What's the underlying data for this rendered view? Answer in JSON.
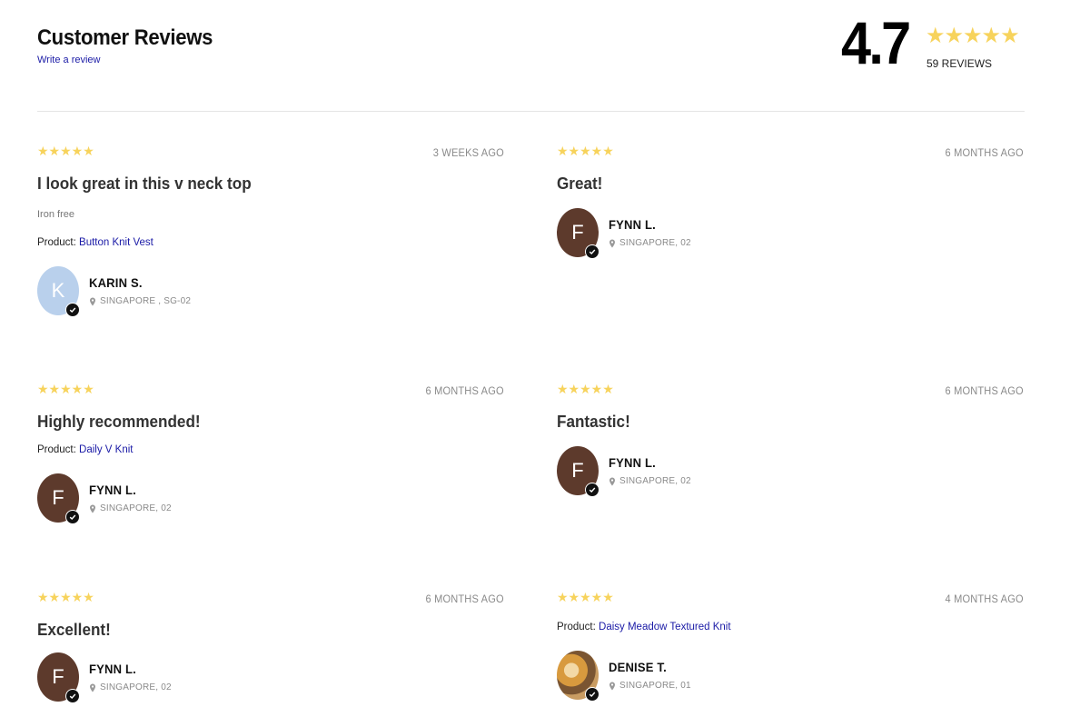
{
  "header": {
    "title": "Customer Reviews",
    "write_review": "Write a review"
  },
  "summary": {
    "score": "4.7",
    "stars": "★★★★★",
    "count": "59 REVIEWS"
  },
  "colors": {
    "star": "#f7d35c",
    "link": "#1a1aa6",
    "avatar_f": "#5d3a2c",
    "avatar_k": "#b9d0ec"
  },
  "reviews": [
    {
      "rating": 5,
      "stars": "★★★★★",
      "date": "3 WEEKS AGO",
      "title": "I look great in this v neck top",
      "body": "Iron free",
      "product_prefix": "Product:",
      "product": "Button Knit Vest",
      "author": {
        "initial": "K",
        "name": "KARIN S.",
        "location": "SINGAPORE , SG-02"
      }
    },
    {
      "rating": 5,
      "stars": "★★★★★",
      "date": "6 MONTHS AGO",
      "title": "Great!",
      "author": {
        "initial": "F",
        "name": "FYNN L.",
        "location": "SINGAPORE, 02"
      }
    },
    {
      "rating": 5,
      "stars": "★★★★★",
      "date": "6 MONTHS AGO",
      "title": "Highly recommended!",
      "product_prefix": "Product:",
      "product": "Daily V Knit",
      "author": {
        "initial": "F",
        "name": "FYNN L.",
        "location": "SINGAPORE, 02"
      }
    },
    {
      "rating": 5,
      "stars": "★★★★★",
      "date": "6 MONTHS AGO",
      "title": "Fantastic!",
      "author": {
        "initial": "F",
        "name": "FYNN L.",
        "location": "SINGAPORE, 02"
      }
    },
    {
      "rating": 5,
      "stars": "★★★★★",
      "date": "6 MONTHS AGO",
      "title": "Excellent!",
      "author": {
        "initial": "F",
        "name": "FYNN L.",
        "location": "SINGAPORE, 02"
      }
    },
    {
      "rating": 5,
      "stars": "★★★★★",
      "date": "4 MONTHS AGO",
      "product_prefix": "Product:",
      "product": "Daisy Meadow Textured Knit",
      "author": {
        "name": "DENISE T.",
        "location": "SINGAPORE, 01"
      }
    }
  ]
}
